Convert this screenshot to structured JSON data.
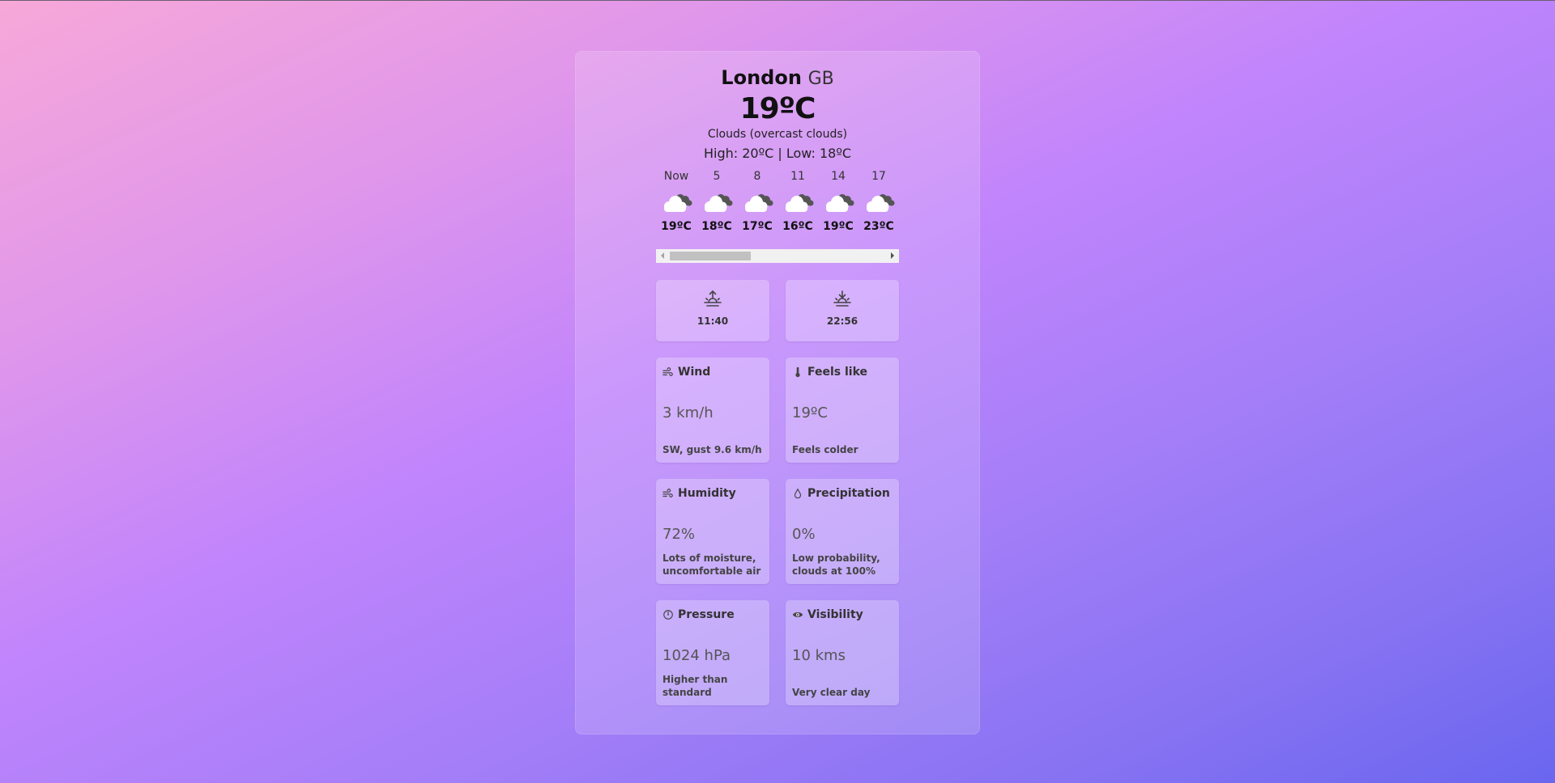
{
  "location": {
    "city": "London",
    "country": "GB"
  },
  "current": {
    "temperature": "19ºC",
    "description": "Clouds (overcast clouds)",
    "high_low": "High: 20ºC | Low: 18ºC"
  },
  "hourly": [
    {
      "label": "Now",
      "temp": "19ºC",
      "icon": "cloud-icon"
    },
    {
      "label": "5",
      "temp": "18ºC",
      "icon": "cloud-icon"
    },
    {
      "label": "8",
      "temp": "17ºC",
      "icon": "cloud-icon"
    },
    {
      "label": "11",
      "temp": "16ºC",
      "icon": "cloud-icon"
    },
    {
      "label": "14",
      "temp": "19ºC",
      "icon": "cloud-icon"
    },
    {
      "label": "17",
      "temp": "23ºC",
      "icon": "cloud-icon"
    }
  ],
  "sun": {
    "sunrise": "11:40",
    "sunset": "22:56"
  },
  "stats": {
    "wind": {
      "title": "Wind",
      "value": "3 km/h",
      "note": "SW, gust 9.6 km/h",
      "icon": "wind-icon"
    },
    "feels_like": {
      "title": "Feels like",
      "value": "19ºC",
      "note": "Feels colder",
      "icon": "thermometer-icon"
    },
    "humidity": {
      "title": "Humidity",
      "value": "72%",
      "note": "Lots of moisture, uncomfortable air",
      "icon": "wind-icon"
    },
    "precipitation": {
      "title": "Precipitation",
      "value": "0%",
      "note": "Low probability, clouds at 100%",
      "icon": "droplet-icon"
    },
    "pressure": {
      "title": "Pressure",
      "value": "1024 hPa",
      "note": "Higher than standard",
      "icon": "gauge-icon"
    },
    "visibility": {
      "title": "Visibility",
      "value": "10 kms",
      "note": "Very clear day",
      "icon": "eye-icon"
    }
  },
  "colors": {
    "gradient_start": "#f7a8d8",
    "gradient_mid": "#c084fc",
    "gradient_end": "#6a66ef"
  }
}
